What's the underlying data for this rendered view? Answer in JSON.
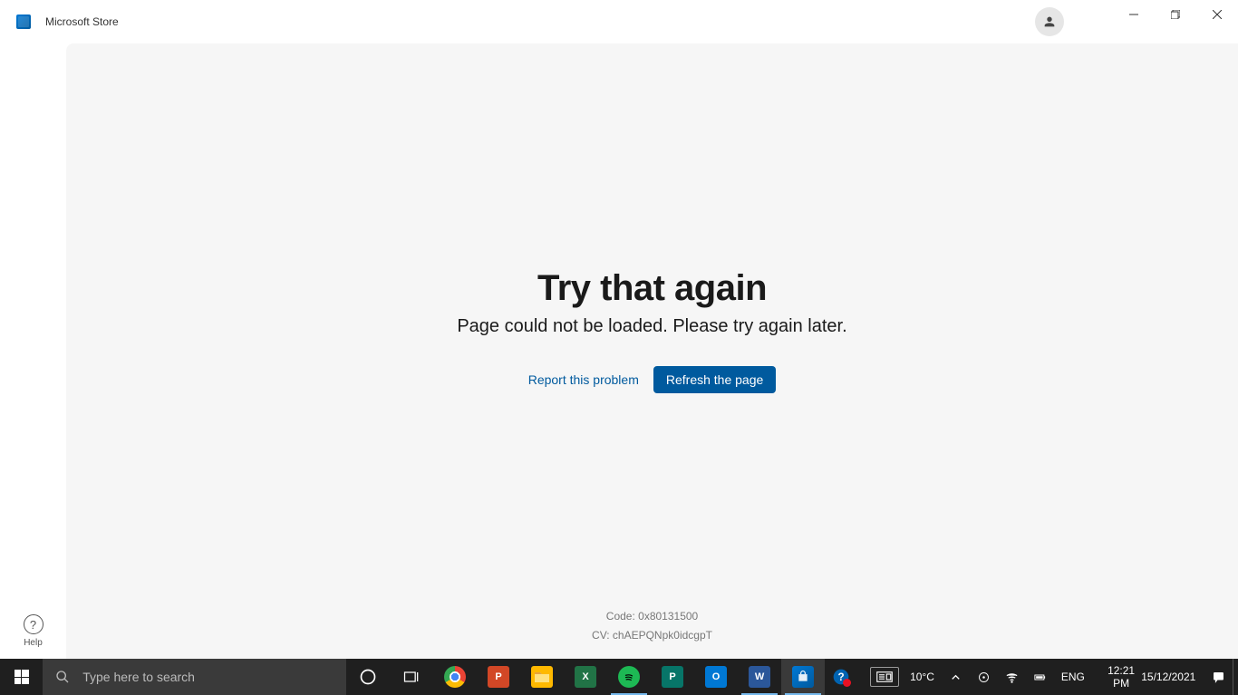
{
  "titlebar": {
    "app_name": "Microsoft Store"
  },
  "sidebar": {
    "help_label": "Help"
  },
  "error": {
    "heading": "Try that again",
    "subtext": "Page could not be loaded. Please try again later.",
    "report_label": "Report this problem",
    "refresh_label": "Refresh the page",
    "code_line": "Code: 0x80131500",
    "cv_line": "CV: chAEPQNpk0idcgpT"
  },
  "taskbar": {
    "search_placeholder": "Type here to search",
    "weather_temp": "10°C",
    "language": "ENG",
    "time": "12:21 PM",
    "date": "15/12/2021"
  }
}
